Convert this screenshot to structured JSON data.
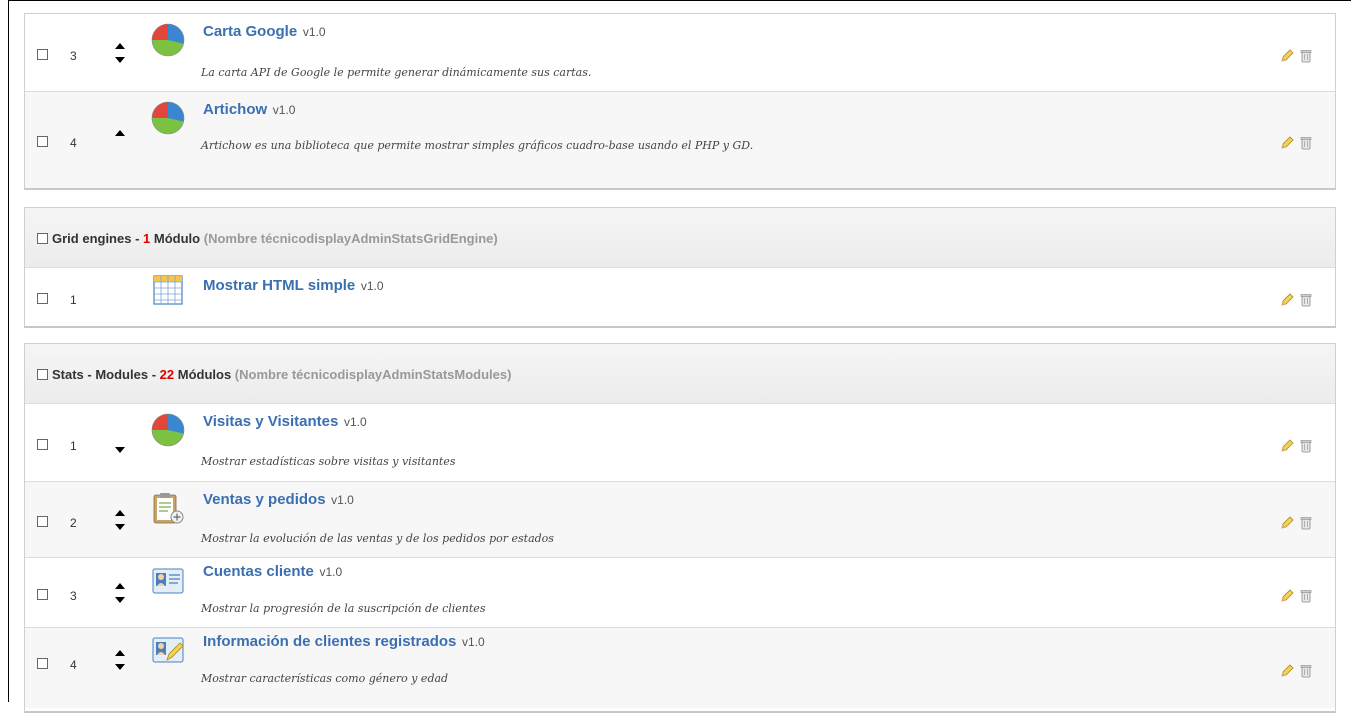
{
  "groups": [
    {
      "show_header": false,
      "modules": [
        {
          "position": "3",
          "name": "Carta Google",
          "version": "v1.0",
          "description": "La carta API de Google le permite generar dinámicamente sus cartas.",
          "icon": "pie-chart-icon",
          "up": true,
          "down": true
        },
        {
          "position": "4",
          "name": "Artichow",
          "version": "v1.0",
          "description": "Artichow es una biblioteca que permite mostrar simples gráficos cuadro-base usando el PHP y GD.",
          "icon": "pie-chart-icon",
          "up": true,
          "down": false
        }
      ]
    },
    {
      "show_header": true,
      "title": "Grid engines",
      "count": "1",
      "count_label": "Módulo",
      "tech_label": "(Nombre técnicodisplayAdminStatsGridEngine)",
      "modules": [
        {
          "position": "1",
          "name": "Mostrar HTML simple",
          "version": "v1.0",
          "description": "",
          "icon": "table-grid-icon",
          "up": false,
          "down": false
        }
      ]
    },
    {
      "show_header": true,
      "title": "Stats - Modules",
      "count": "22",
      "count_label": "Módulos",
      "tech_label": "(Nombre técnicodisplayAdminStatsModules)",
      "modules": [
        {
          "position": "1",
          "name": "Visitas y Visitantes",
          "version": "v1.0",
          "description": "Mostrar estadísticas sobre visitas y visitantes",
          "icon": "pie-chart-icon",
          "up": false,
          "down": true
        },
        {
          "position": "2",
          "name": "Ventas y pedidos",
          "version": "v1.0",
          "description": "Mostrar la evolución de las ventas y de los pedidos por estados",
          "icon": "clipboard-icon",
          "up": true,
          "down": true
        },
        {
          "position": "3",
          "name": "Cuentas cliente",
          "version": "v1.0",
          "description": "Mostrar la progresión de la suscripción de clientes",
          "icon": "id-card-icon",
          "up": true,
          "down": true
        },
        {
          "position": "4",
          "name": "Información de clientes registrados",
          "version": "v1.0",
          "description": "Mostrar características como género y edad",
          "icon": "id-card-edit-icon",
          "up": true,
          "down": true
        }
      ]
    }
  ],
  "colors": {
    "link": "#3a6fb0",
    "count": "#e00000",
    "tech": "#999999"
  }
}
